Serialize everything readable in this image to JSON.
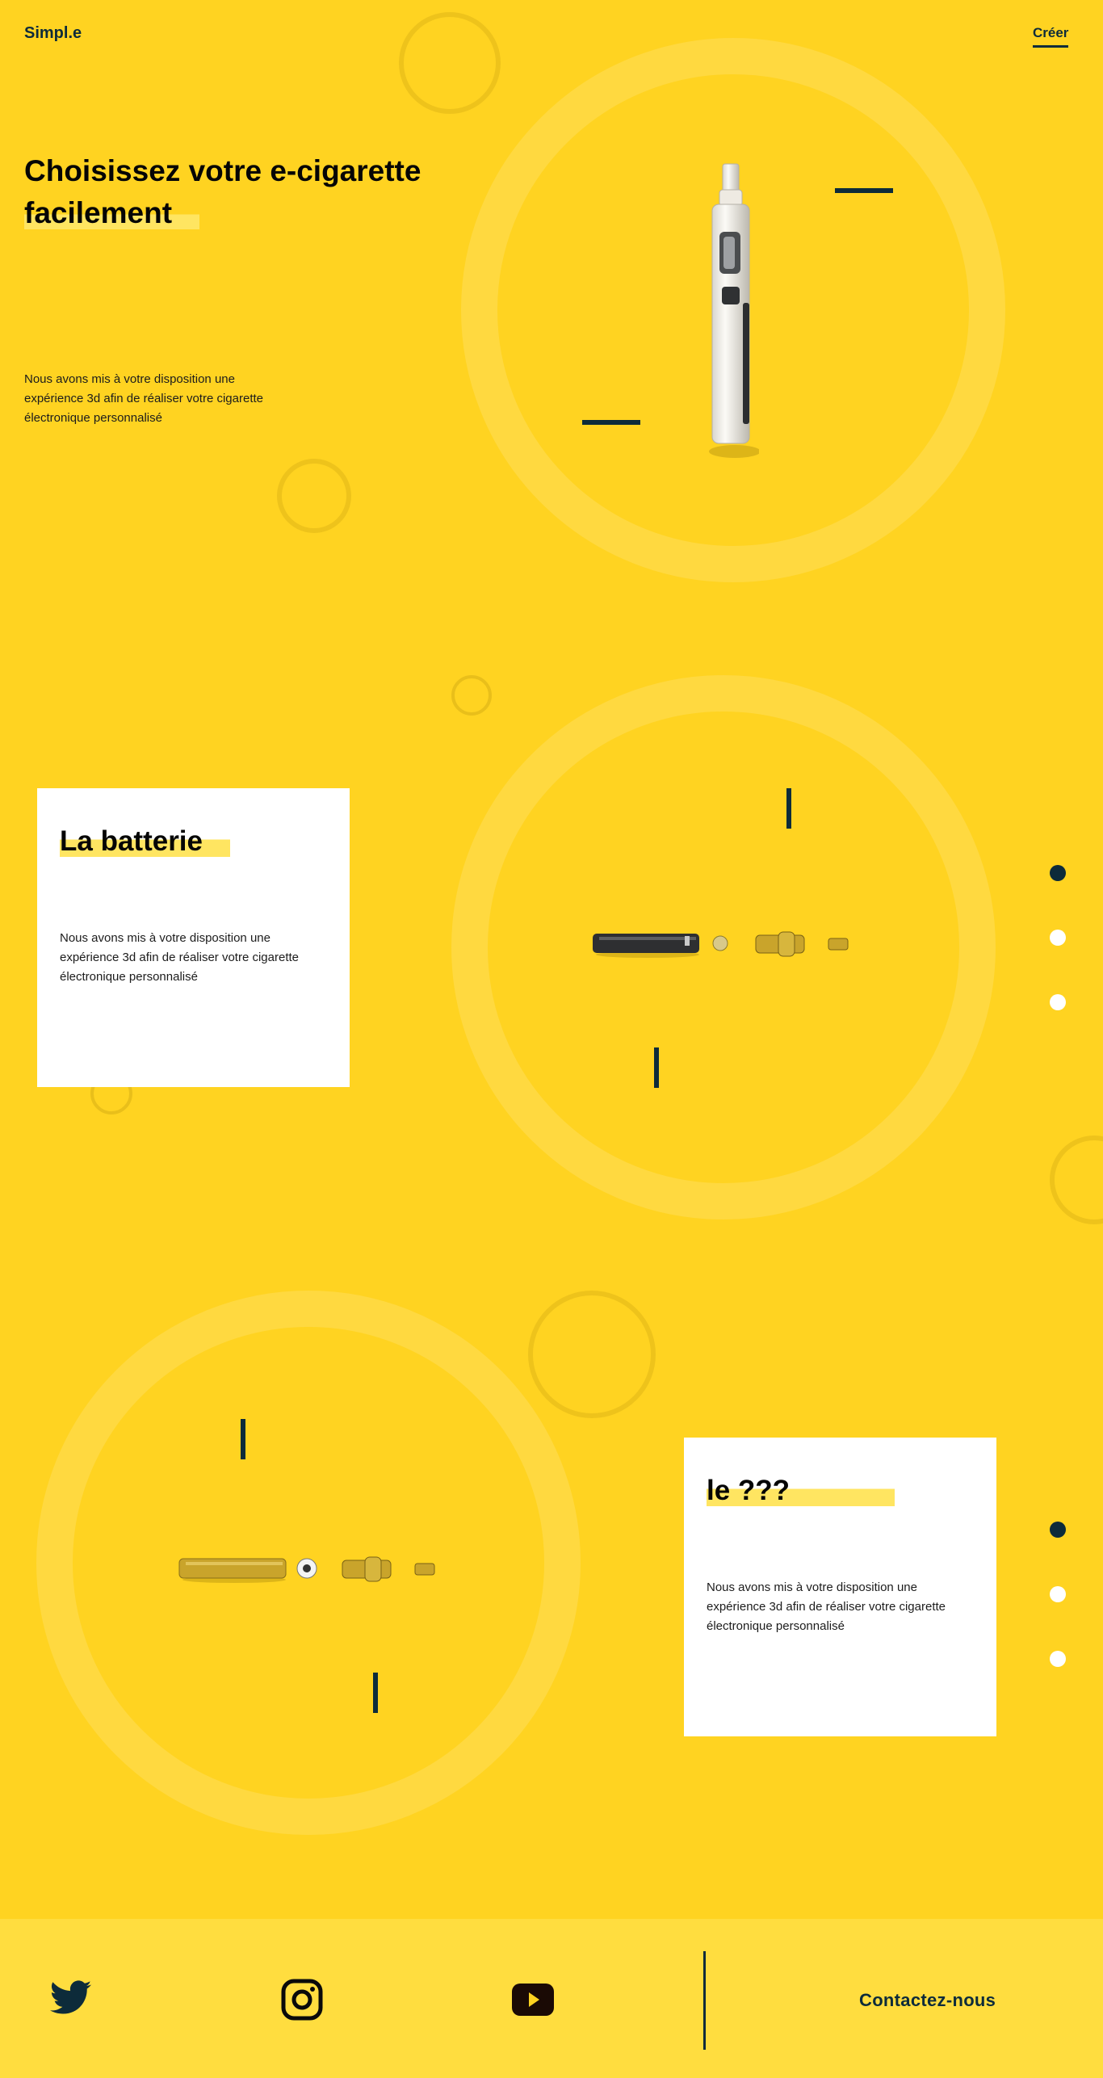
{
  "header": {
    "logo": "Simpl.e",
    "nav_create": "Créer"
  },
  "hero": {
    "title_line1": "Choisissez votre e-cigarette",
    "title_line2": "facilement",
    "description": "Nous avons mis à votre disposition une expérience 3d afin de réaliser votre cigarette électronique personnalisé",
    "product_icon": "ecigarette-device-image"
  },
  "section_battery": {
    "title": "La batterie",
    "description": "Nous avons mis à votre disposition une expérience 3d afin de réaliser votre cigarette électronique personnalisé",
    "product_icon": "ecigarette-exploded-dark-image"
  },
  "section_unknown": {
    "title": "le ???",
    "description": "Nous avons mis à votre disposition une expérience 3d afin de réaliser votre cigarette électronique personnalisé",
    "product_icon": "ecigarette-exploded-gold-image"
  },
  "pagers": {
    "battery": [
      true,
      false,
      false
    ],
    "unknown": [
      true,
      false,
      false
    ]
  },
  "footer": {
    "social": [
      "twitter-icon",
      "instagram-icon",
      "youtube-icon"
    ],
    "contact": "Contactez-nous"
  },
  "colors": {
    "background": "#ffd321",
    "highlight": "#ffe561",
    "dark": "#0d2b3a",
    "card": "#ffffff"
  }
}
